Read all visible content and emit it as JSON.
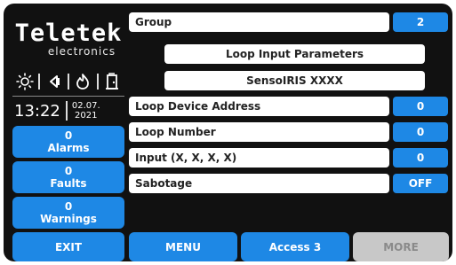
{
  "logo": {
    "brand": "Teletek",
    "sub": "electronics"
  },
  "status_icons": [
    "sun-icon",
    "speaker-icon",
    "flame-icon",
    "door-icon"
  ],
  "clock": {
    "time": "13:22",
    "date_line1": "02.07.",
    "date_line2": "2021"
  },
  "counters": [
    {
      "count": "0",
      "label": "Alarms"
    },
    {
      "count": "0",
      "label": "Faults"
    },
    {
      "count": "0",
      "label": "Warnings"
    }
  ],
  "group": {
    "label": "Group",
    "value": "2"
  },
  "section_title": "Loop Input Parameters",
  "device_name": "SensoIRIS XXXX",
  "params": [
    {
      "label": "Loop Device Address",
      "value": "0"
    },
    {
      "label": "Loop Number",
      "value": "0"
    },
    {
      "label": "Input (X, X, X, X)",
      "value": "0"
    },
    {
      "label": "Sabotage",
      "value": "OFF"
    }
  ],
  "buttons": {
    "exit": "EXIT",
    "menu": "MENU",
    "access": "Access 3",
    "more": "MORE"
  }
}
